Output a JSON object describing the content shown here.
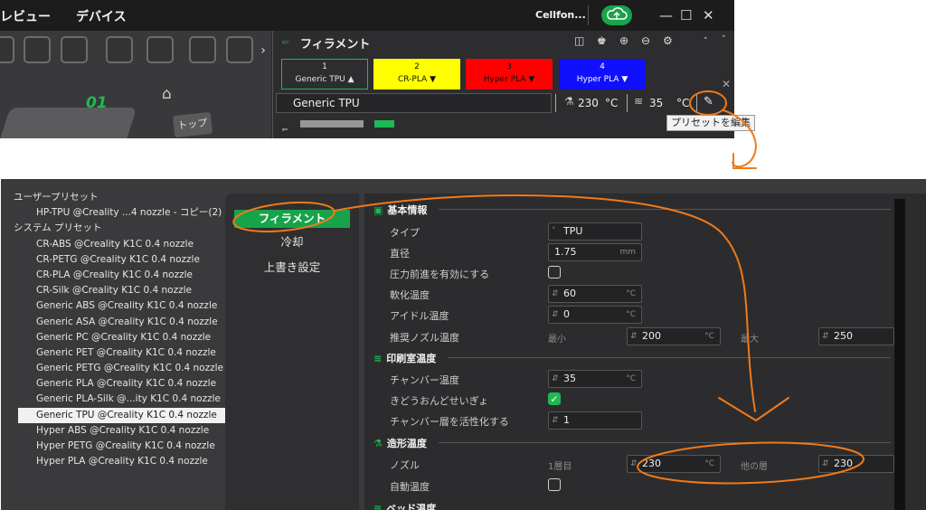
{
  "top": {
    "menu": [
      "レビュー",
      "デバイス"
    ],
    "user": "Cellfon...",
    "window_controls": [
      "—",
      "☐",
      "✕"
    ],
    "plate_number": "01",
    "top_view_label": "トップ",
    "filament_panel": {
      "title": "フィラメント",
      "slots": [
        {
          "number": "1",
          "name": "Generic TPU ▲",
          "color": "#2d2d2f",
          "text_color": "#e6e6e6",
          "border": "#1db954"
        },
        {
          "number": "2",
          "name": "CR-PLA ▼",
          "color": "#ffff00",
          "text_color": "#111111",
          "border": "#ffff00"
        },
        {
          "number": "3",
          "name": "Hyper PLA ▼",
          "color": "#ff0000",
          "text_color": "#111111",
          "border": "#ff0000"
        },
        {
          "number": "4",
          "name": "Hyper PLA ▼",
          "color": "#1010ff",
          "text_color": "#ffffff",
          "border": "#1010ff"
        }
      ],
      "selected_preset": "Generic TPU",
      "nozzle_temp": "230",
      "nozzle_unit": "°C",
      "bed_temp": "35",
      "bed_unit": "°C",
      "tooltip": "プリセットを編集"
    }
  },
  "bottom": {
    "groups": [
      {
        "label": "ユーザープリセット",
        "items": [
          "HP-TPU @Creality ...4 nozzle - コピー(2)"
        ]
      },
      {
        "label": "システム プリセット",
        "items": [
          "CR-ABS @Creality K1C 0.4 nozzle",
          "CR-PETG @Creality K1C 0.4 nozzle",
          "CR-PLA @Creality K1C 0.4 nozzle",
          "CR-Silk @Creality K1C 0.4 nozzle",
          "Generic ABS @Creality K1C 0.4 nozzle",
          "Generic ASA @Creality K1C 0.4 nozzle",
          "Generic PC @Creality K1C 0.4 nozzle",
          "Generic PET @Creality K1C 0.4 nozzle",
          "Generic PETG @Creality K1C 0.4 nozzle",
          "Generic PLA @Creality K1C 0.4 nozzle",
          "Generic PLA-Silk @...ity K1C 0.4 nozzle",
          "Generic TPU @Creality K1C 0.4 nozzle",
          "Hyper ABS @Creality K1C 0.4 nozzle",
          "Hyper PETG @Creality K1C 0.4 nozzle",
          "Hyper PLA @Creality K1C 0.4 nozzle"
        ]
      }
    ],
    "selected_item": "Generic TPU @Creality K1C 0.4 nozzle",
    "tabs": [
      "フィラメント",
      "冷却",
      "上書き設定"
    ],
    "active_tab": "フィラメント",
    "sections": {
      "basic": {
        "title": "基本情報",
        "type_label": "タイプ",
        "type_value": "TPU",
        "diameter_label": "直径",
        "diameter_value": "1.75",
        "diameter_unit": "mm",
        "pressure_label": "圧力前進を有効にする",
        "softening_label": "軟化温度",
        "softening_value": "60",
        "softening_unit": "°C",
        "idle_label": "アイドル温度",
        "idle_value": "0",
        "idle_unit": "°C",
        "rec_label": "推奨ノズル温度",
        "rec_min_label": "最小",
        "rec_min_value": "200",
        "rec_min_unit": "°C",
        "rec_max_label": "最大",
        "rec_max_value": "250"
      },
      "chamber": {
        "title": "印刷室温度",
        "chamber_temp_label": "チャンバー温度",
        "chamber_temp_value": "35",
        "chamber_temp_unit": "°C",
        "auto_control_label": "きどうおんどせいぎょ",
        "activate_label": "チャンバー層を活性化する",
        "activate_value": "1"
      },
      "print_temp": {
        "title": "造形温度",
        "nozzle_label": "ノズル",
        "first_layer_label": "1層目",
        "first_layer_value": "230",
        "first_layer_unit": "°C",
        "other_layers_label": "他の層",
        "other_layers_value": "230",
        "auto_temp_label": "自動温度"
      },
      "bed": {
        "title": "ベッド温度"
      }
    }
  },
  "colors": {
    "accent": "#1db954",
    "annotation": "#f07a1a"
  }
}
